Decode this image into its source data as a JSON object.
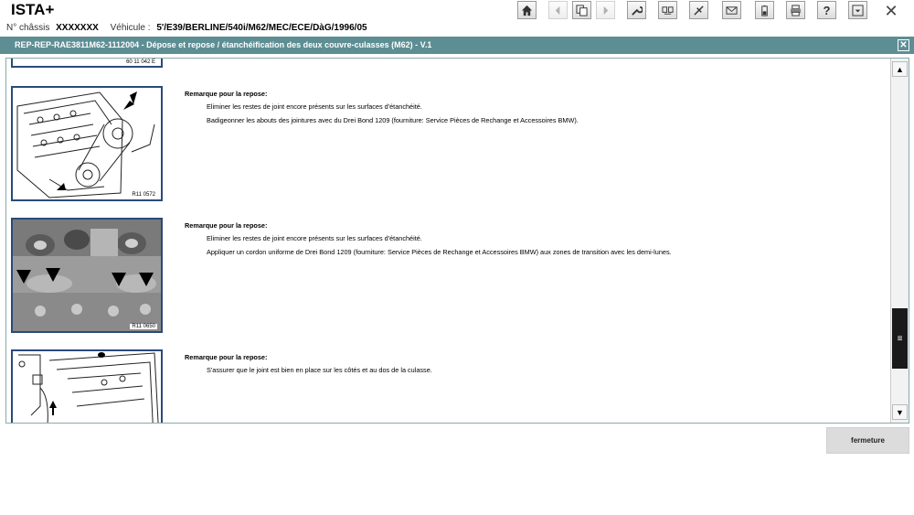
{
  "app": {
    "title": "ISTA+"
  },
  "vehicle": {
    "chassis_label": "N° châssis",
    "chassis_value": "XXXXXXX",
    "vehicle_label": "Véhicule :",
    "vehicle_value": "5'/E39/BERLINE/540i/M62/MEC/ECE/DàG/1996/05"
  },
  "toolbar": {
    "icons": [
      "home-icon",
      "back-arrow-icon",
      "copy-icon",
      "forward-arrow-icon",
      "wrench-icon",
      "diagnosis-icon",
      "connection-icon",
      "mail-icon",
      "battery-icon",
      "print-icon",
      "help-icon",
      "menu-icon",
      "close-icon"
    ],
    "help_glyph": "?",
    "close_glyph": "✕"
  },
  "document": {
    "header_title": "REP-REP-RAE3811M62-1112004  -  Dépose et repose / étanchéification des deux couvre-culasses (M62)  -  V.1",
    "close_glyph": "✕",
    "partial_figure_code": "60 11 042 E",
    "sections": [
      {
        "figure_code": "R11 0572",
        "title": "Remarque pour la repose:",
        "lines": [
          "Eliminer les restes de joint encore présents sur les surfaces d'étanchéité.",
          "Badigeonner les abouts des jointures avec du Drei Bond 1209 (fourniture: Service Pièces de Rechange et Accessoires BMW)."
        ]
      },
      {
        "figure_code": "R11 0650",
        "title": "Remarque pour la repose:",
        "lines": [
          "Eliminer les restes de joint encore présents sur les surfaces d'étanchéité.",
          "Appliquer un cordon uniforme de Drei Bond 1209 (fourniture: Service Pièces de Rechange et Accessoires BMW) aux zones de transition avec les demi-lunes."
        ]
      },
      {
        "figure_code": "",
        "title": "Remarque pour la repose:",
        "lines": [
          "S'assurer que le joint est bien en place sur les côtés et au dos de la culasse."
        ]
      }
    ]
  },
  "scrollbar": {
    "up_glyph": "▲",
    "down_glyph": "▼",
    "thumb_glyph": "≡"
  },
  "footer": {
    "close_label": "fermeture"
  }
}
